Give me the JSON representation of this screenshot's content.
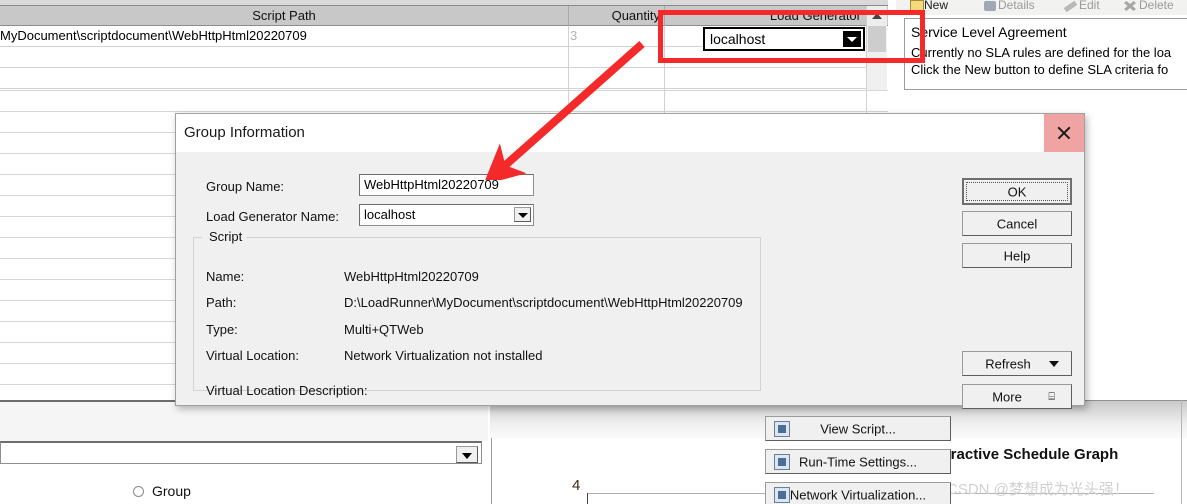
{
  "grid": {
    "columns": [
      {
        "label": "Script Path",
        "align": "center"
      },
      {
        "label": "Quantity",
        "align": "right"
      },
      {
        "label": "Load Generator",
        "align": "right"
      }
    ],
    "rows": [
      {
        "script_path": "MyDocument\\scriptdocument\\WebHttpHtml20220709",
        "quantity": "3",
        "load_generator": "localhost"
      }
    ],
    "editor_value": "localhost"
  },
  "right_panel": {
    "toolbar": [
      {
        "label": "New",
        "icon": "new-page-icon",
        "enabled": true
      },
      {
        "label": "Details",
        "icon": "details-icon",
        "enabled": false
      },
      {
        "label": "Edit",
        "icon": "edit-pencil-icon",
        "enabled": false
      },
      {
        "label": "Delete",
        "icon": "delete-x-icon",
        "enabled": false
      }
    ],
    "sla": {
      "title": "Service Level Agreement",
      "line1": "Currently no SLA rules are defined for the loa",
      "line2": "Click the New button to define SLA criteria fo"
    }
  },
  "dialog": {
    "title": "Group Information",
    "close_label": "×",
    "fields": {
      "group_name_label": "Group Name:",
      "group_name_value": "WebHttpHtml20220709",
      "load_generator_label": "Load Generator Name:",
      "load_generator_value": "localhost"
    },
    "script_group": {
      "legend": "Script",
      "rows": [
        {
          "label": "Name:",
          "value": "WebHttpHtml20220709"
        },
        {
          "label": "Path:",
          "value": "D:\\LoadRunner\\MyDocument\\scriptdocument\\WebHttpHtml20220709"
        },
        {
          "label": "Type:",
          "value": "Multi+QTWeb"
        },
        {
          "label": "Virtual Location:",
          "value": "Network Virtualization not installed"
        },
        {
          "label": "Virtual Location Description:",
          "value": ""
        }
      ],
      "buttons": [
        {
          "label": "View Script...",
          "icon": "script-page-icon"
        },
        {
          "label": "Run-Time Settings...",
          "icon": "runtime-settings-icon"
        },
        {
          "label": "Network Virtualization...",
          "icon": "network-monitor-icon"
        }
      ]
    },
    "action_buttons": [
      {
        "label": "OK",
        "default": true
      },
      {
        "label": "Cancel",
        "default": false
      },
      {
        "label": "Help",
        "default": false
      }
    ],
    "extra_buttons": [
      {
        "label": "Refresh",
        "arrow": "chevron-down-icon"
      },
      {
        "label": "More",
        "arrow": "double-chevron-down-icon"
      }
    ]
  },
  "bottom": {
    "combo_value": "",
    "radio_label": "Group",
    "radio_checked": false
  },
  "chart": {
    "title": "Interactive Schedule Graph",
    "y_tick": "4"
  },
  "watermark": "CSDN @梦想成为光头强！",
  "colors": {
    "annotation_red": "#f42a2a",
    "close_button_bg": "#f0a3a3",
    "grid_header_bg": "#c8c8c8",
    "dialog_bg": "#f0f0f0"
  }
}
